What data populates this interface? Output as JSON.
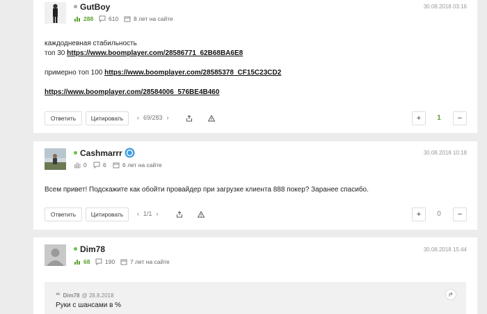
{
  "posts": [
    {
      "username": "GutBoy",
      "online_color": "#aaaaaa",
      "rating": "288",
      "messages": "610",
      "site_age": "8 лет на сайте",
      "date": "30.08.2018 03:16",
      "body": {
        "line1": "каждодневная стабильность",
        "line2_prefix": "топ 30 ",
        "link1": "https://www.boomplayer.com/28586771_62B68BA6E8",
        "line3_prefix": "примерно топ 100 ",
        "link2": "https://www.boomplayer.com/28585378_CF15C23CD2",
        "link3": "https://www.boomplayer.com/28584006_576BE4B460"
      },
      "reply_label": "Ответить",
      "quote_label": "Цитировать",
      "pager": "69/283",
      "score": "1",
      "score_color": "#5aa02c"
    },
    {
      "username": "Cashmarrr",
      "online_color": "#6cc04a",
      "rating": "0",
      "messages": "6",
      "site_age": "6 лет на сайте",
      "date": "30.08.2018 10:18",
      "body": {
        "text": "Всем привет! Подскажите как обойти провайдер при загрузке клиента 888 покер? Заранее спасибо."
      },
      "reply_label": "Ответить",
      "quote_label": "Цитировать",
      "pager": "1/1",
      "score": "0",
      "score_color": "#888888"
    },
    {
      "username": "Dim78",
      "online_color": "#6cc04a",
      "rating": "68",
      "messages": "190",
      "site_age": "7 лет на сайте",
      "date": "30.08.2018 15:44",
      "quote": {
        "author": "Dim78",
        "date": "@ 28.8.2018",
        "text": "Руки с шансами в %"
      }
    }
  ],
  "icons": {
    "rating": "bar-chart-icon",
    "messages": "speech-bubble-icon",
    "calendar": "calendar-icon",
    "share": "share-icon",
    "report": "warning-icon",
    "quote_mark": "quote-icon",
    "expand": "arrow-icon",
    "verified": "verified-badge-icon"
  }
}
